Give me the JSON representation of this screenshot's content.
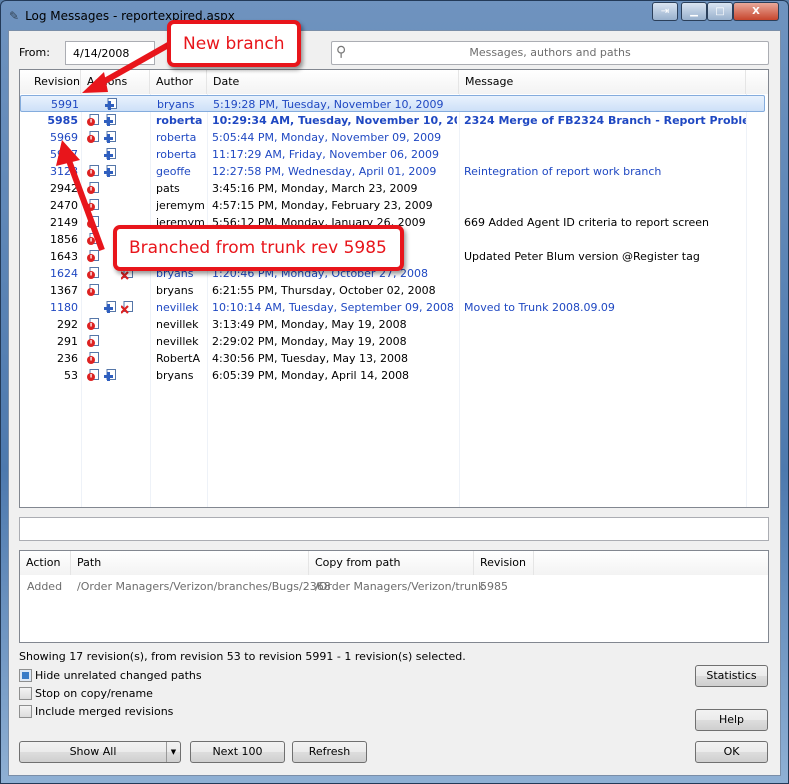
{
  "window": {
    "title": "Log Messages - reportexpired.aspx"
  },
  "filter": {
    "from_label": "From:",
    "from_value": "4/14/2008",
    "search_placeholder": "Messages, authors and paths"
  },
  "log": {
    "columns": [
      "Revision",
      "Actions",
      "Author",
      "Date",
      "Message"
    ],
    "rows": [
      {
        "revision": "5991",
        "author": "bryans",
        "date": "5:19:28 PM, Tuesday, November 10, 2009",
        "message": "",
        "color": "blue",
        "bold": false,
        "selected": true,
        "icons": [
          "",
          "added",
          ""
        ]
      },
      {
        "revision": "5985",
        "author": "roberta",
        "date": "10:29:34 AM, Tuesday, November 10, 2009",
        "message": "2324 Merge of FB2324 Branch - Report Problems",
        "color": "blue",
        "bold": true,
        "icons": [
          "modified",
          "added",
          ""
        ]
      },
      {
        "revision": "5969",
        "author": "roberta",
        "date": "5:05:44 PM, Monday, November 09, 2009",
        "message": "",
        "color": "blue",
        "bold": false,
        "icons": [
          "modified",
          "added",
          ""
        ]
      },
      {
        "revision": "5947",
        "author": "roberta",
        "date": "11:17:29 AM, Friday, November 06, 2009",
        "message": "",
        "color": "blue",
        "bold": false,
        "icons": [
          "",
          "added",
          ""
        ]
      },
      {
        "revision": "3128",
        "author": "geoffe",
        "date": "12:27:58 PM, Wednesday, April 01, 2009",
        "message": "Reintegration of report work branch",
        "color": "blue",
        "bold": false,
        "icons": [
          "modified",
          "added",
          ""
        ]
      },
      {
        "revision": "2942",
        "author": "pats",
        "date": "3:45:16 PM, Monday, March 23, 2009",
        "message": "",
        "color": "black",
        "bold": false,
        "icons": [
          "modified",
          "",
          ""
        ]
      },
      {
        "revision": "2470",
        "author": "jeremym",
        "date": "4:57:15 PM, Monday, February 23, 2009",
        "message": "",
        "color": "black",
        "bold": false,
        "icons": [
          "modified",
          "",
          ""
        ]
      },
      {
        "revision": "2149",
        "author": "jeremym",
        "date": "5:56:12 PM, Monday, January 26, 2009",
        "message": "669 Added Agent ID criteria to report screen",
        "color": "black",
        "bold": false,
        "icons": [
          "modified",
          "",
          ""
        ]
      },
      {
        "revision": "1856",
        "author": "",
        "date": "2008",
        "message": "",
        "color": "black",
        "bold": false,
        "icons": [
          "modified",
          "",
          ""
        ]
      },
      {
        "revision": "1643",
        "author": "",
        "date": "",
        "message": "Updated Peter Blum version @Register tag",
        "color": "black",
        "bold": false,
        "icons": [
          "modified",
          "",
          ""
        ]
      },
      {
        "revision": "1624",
        "author": "bryans",
        "date": "1:20:46 PM, Monday, October 27, 2008",
        "message": "",
        "color": "blue",
        "bold": false,
        "icons": [
          "modified",
          "",
          "deleted"
        ]
      },
      {
        "revision": "1367",
        "author": "bryans",
        "date": "6:21:55 PM, Thursday, October 02, 2008",
        "message": "",
        "color": "black",
        "bold": false,
        "icons": [
          "modified",
          "",
          ""
        ]
      },
      {
        "revision": "1180",
        "author": "nevillek",
        "date": "10:10:14 AM, Tuesday, September 09, 2008",
        "message": "Moved to Trunk 2008.09.09",
        "color": "blue",
        "bold": false,
        "icons": [
          "",
          "added",
          "deleted"
        ]
      },
      {
        "revision": "292",
        "author": "nevillek",
        "date": "3:13:49 PM, Monday, May 19, 2008",
        "message": "",
        "color": "black",
        "bold": false,
        "icons": [
          "modified",
          "",
          ""
        ]
      },
      {
        "revision": "291",
        "author": "nevillek",
        "date": "2:29:02 PM, Monday, May 19, 2008",
        "message": "",
        "color": "black",
        "bold": false,
        "icons": [
          "modified",
          "",
          ""
        ]
      },
      {
        "revision": "236",
        "author": "RobertA",
        "date": "4:30:56 PM, Tuesday, May 13, 2008",
        "message": "",
        "color": "black",
        "bold": false,
        "icons": [
          "modified",
          "",
          ""
        ]
      },
      {
        "revision": "53",
        "author": "bryans",
        "date": "6:05:39 PM, Monday, April 14, 2008",
        "message": "",
        "color": "black",
        "bold": false,
        "icons": [
          "modified",
          "added",
          ""
        ]
      }
    ]
  },
  "paths": {
    "columns": [
      "Action",
      "Path",
      "Copy from path",
      "Revision"
    ],
    "rows": [
      {
        "action": "Added",
        "path": "/Order Managers/Verizon/branches/Bugs/2368",
        "copy_from": "/Order Managers/Verizon/trunk",
        "revision": "5985"
      }
    ]
  },
  "status": "Showing 17 revision(s), from revision 53 to revision 5991 - 1 revision(s) selected.",
  "options": [
    {
      "label": "Hide unrelated changed paths",
      "checked": true
    },
    {
      "label": "Stop on copy/rename",
      "checked": false
    },
    {
      "label": "Include merged revisions",
      "checked": false
    }
  ],
  "buttons": {
    "show_all": "Show All",
    "next": "Next 100",
    "refresh": "Refresh",
    "statistics": "Statistics",
    "help": "Help",
    "ok": "OK"
  },
  "annotations": {
    "new_branch": "New branch",
    "branched_from": "Branched from trunk rev 5985"
  },
  "colors": {
    "blue": "#1f48c2",
    "black": "#000000",
    "callout": "#e8151b"
  }
}
